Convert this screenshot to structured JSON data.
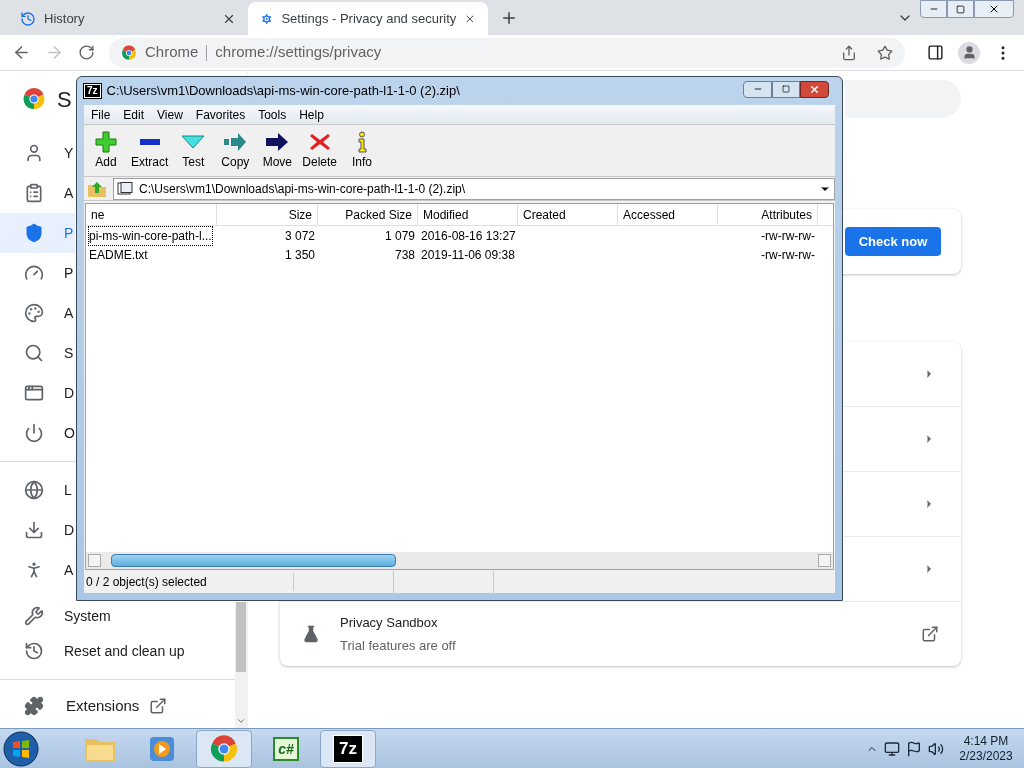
{
  "browser": {
    "tabs": [
      {
        "label": "History",
        "kind": "history",
        "selected": false
      },
      {
        "label": "Settings - Privacy and security",
        "kind": "settings",
        "selected": true
      }
    ],
    "site_label": "Chrome",
    "url": "chrome://settings/privacy"
  },
  "settings": {
    "heading": "S",
    "sidebar": [
      {
        "label": "Y",
        "kind": "person",
        "selected": false
      },
      {
        "label": "A",
        "kind": "clipboard",
        "selected": false
      },
      {
        "label": "P",
        "kind": "shield",
        "selected": true
      },
      {
        "label": "P",
        "kind": "gauge",
        "selected": false
      },
      {
        "label": "A",
        "kind": "palette",
        "selected": false
      },
      {
        "label": "S",
        "kind": "search",
        "selected": false
      },
      {
        "label": "D",
        "kind": "browser",
        "selected": false
      },
      {
        "label": "O",
        "kind": "power",
        "selected": false
      }
    ],
    "sidebar_advanced": [
      {
        "label": "L",
        "kind": "globe",
        "selected": false
      },
      {
        "label": "D",
        "kind": "download",
        "selected": false
      },
      {
        "label": "A",
        "kind": "accessibility",
        "selected": false
      },
      {
        "label": "System",
        "kind": "wrench",
        "selected": false
      },
      {
        "label": "Reset and clean up",
        "kind": "history",
        "selected": false
      }
    ],
    "extensions": "Extensions",
    "check_button": "Check now",
    "sandbox": {
      "title": "Privacy Sandbox",
      "subtitle": "Trial features are off"
    }
  },
  "sevenzip": {
    "logo": "7z",
    "title": "C:\\Users\\vm1\\Downloads\\api-ms-win-core-path-l1-1-0 (2).zip\\",
    "menu": [
      "File",
      "Edit",
      "View",
      "Favorites",
      "Tools",
      "Help"
    ],
    "toolbar": [
      {
        "label": "Add",
        "kind": "add"
      },
      {
        "label": "Extract",
        "kind": "extract"
      },
      {
        "label": "Test",
        "kind": "test"
      },
      {
        "label": "Copy",
        "kind": "copy"
      },
      {
        "label": "Move",
        "kind": "move"
      },
      {
        "label": "Delete",
        "kind": "delete"
      },
      {
        "label": "Info",
        "kind": "info"
      }
    ],
    "path": "C:\\Users\\vm1\\Downloads\\api-ms-win-core-path-l1-1-0 (2).zip\\",
    "columns": [
      "ne",
      "Size",
      "Packed Size",
      "Modified",
      "Created",
      "Accessed",
      "Attributes"
    ],
    "rows": [
      {
        "cells": [
          "pi-ms-win-core-path-l...",
          "3 072",
          "1 079",
          "2016-08-16 13:27",
          "",
          "",
          "-rw-rw-rw-"
        ],
        "focused": true
      },
      {
        "cells": [
          "EADME.txt",
          "1 350",
          "738",
          "2019-11-06 09:38",
          "",
          "",
          "-rw-rw-rw-"
        ],
        "focused": false
      }
    ],
    "status": "0 / 2 object(s) selected"
  },
  "taskbar": {
    "apps": [
      {
        "kind": "explorer",
        "selected": false
      },
      {
        "kind": "media",
        "selected": false
      },
      {
        "kind": "chrome",
        "selected": true
      },
      {
        "kind": "csharp",
        "label": "c#",
        "selected": false
      },
      {
        "kind": "sevenzip",
        "label": "7z",
        "selected": true
      }
    ],
    "time": "4:14 PM",
    "date": "2/23/2023"
  }
}
